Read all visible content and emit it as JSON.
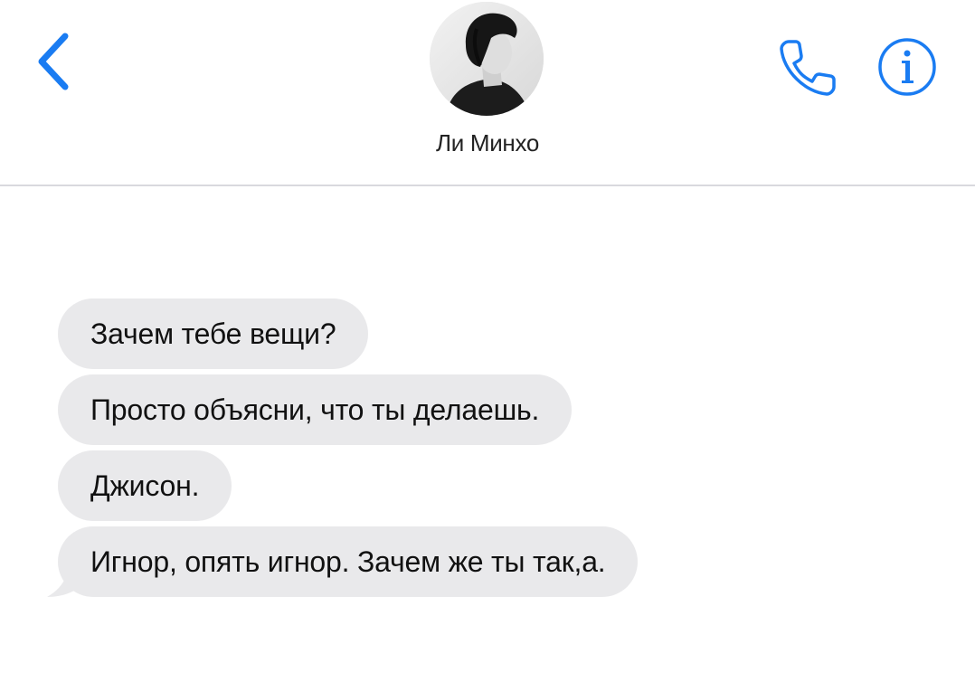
{
  "header": {
    "contact_name": "Ли Минхо",
    "accent_color": "#1a7cf2",
    "back_icon": "chevron-left-icon",
    "call_icon": "phone-icon",
    "info_icon": "info-icon",
    "avatar": "contact-avatar-photo"
  },
  "messages": [
    {
      "direction": "incoming",
      "text": "Зачем тебе вещи?"
    },
    {
      "direction": "incoming",
      "text": "Просто объясни, что ты делаешь."
    },
    {
      "direction": "incoming",
      "text": "Джисон."
    },
    {
      "direction": "incoming",
      "text": "Игнор, опять игнор. Зачем же ты так,а."
    }
  ],
  "colors": {
    "incoming_bubble": "#e9e9eb",
    "background": "#ffffff"
  }
}
